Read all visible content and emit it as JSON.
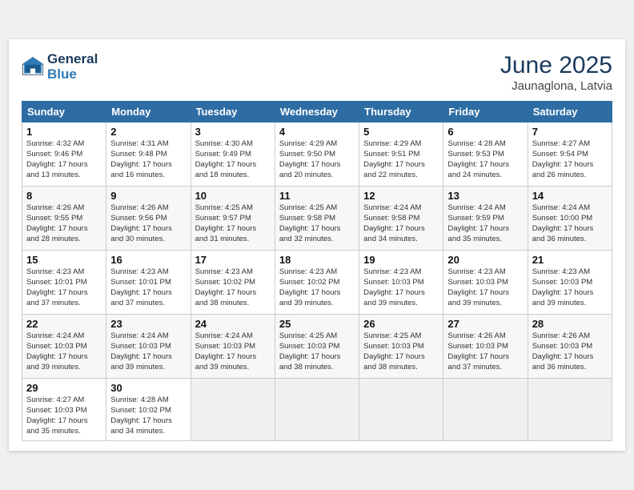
{
  "header": {
    "logo_line1": "General",
    "logo_line2": "Blue",
    "month": "June 2025",
    "location": "Jaunaglona, Latvia"
  },
  "weekdays": [
    "Sunday",
    "Monday",
    "Tuesday",
    "Wednesday",
    "Thursday",
    "Friday",
    "Saturday"
  ],
  "weeks": [
    [
      {
        "day": "1",
        "rise": "4:32 AM",
        "set": "9:46 PM",
        "daylight": "17 hours and 13 minutes."
      },
      {
        "day": "2",
        "rise": "4:31 AM",
        "set": "9:48 PM",
        "daylight": "17 hours and 16 minutes."
      },
      {
        "day": "3",
        "rise": "4:30 AM",
        "set": "9:49 PM",
        "daylight": "17 hours and 18 minutes."
      },
      {
        "day": "4",
        "rise": "4:29 AM",
        "set": "9:50 PM",
        "daylight": "17 hours and 20 minutes."
      },
      {
        "day": "5",
        "rise": "4:29 AM",
        "set": "9:51 PM",
        "daylight": "17 hours and 22 minutes."
      },
      {
        "day": "6",
        "rise": "4:28 AM",
        "set": "9:53 PM",
        "daylight": "17 hours and 24 minutes."
      },
      {
        "day": "7",
        "rise": "4:27 AM",
        "set": "9:54 PM",
        "daylight": "17 hours and 26 minutes."
      }
    ],
    [
      {
        "day": "8",
        "rise": "4:26 AM",
        "set": "9:55 PM",
        "daylight": "17 hours and 28 minutes."
      },
      {
        "day": "9",
        "rise": "4:26 AM",
        "set": "9:56 PM",
        "daylight": "17 hours and 30 minutes."
      },
      {
        "day": "10",
        "rise": "4:25 AM",
        "set": "9:57 PM",
        "daylight": "17 hours and 31 minutes."
      },
      {
        "day": "11",
        "rise": "4:25 AM",
        "set": "9:58 PM",
        "daylight": "17 hours and 32 minutes."
      },
      {
        "day": "12",
        "rise": "4:24 AM",
        "set": "9:58 PM",
        "daylight": "17 hours and 34 minutes."
      },
      {
        "day": "13",
        "rise": "4:24 AM",
        "set": "9:59 PM",
        "daylight": "17 hours and 35 minutes."
      },
      {
        "day": "14",
        "rise": "4:24 AM",
        "set": "10:00 PM",
        "daylight": "17 hours and 36 minutes."
      }
    ],
    [
      {
        "day": "15",
        "rise": "4:23 AM",
        "set": "10:01 PM",
        "daylight": "17 hours and 37 minutes."
      },
      {
        "day": "16",
        "rise": "4:23 AM",
        "set": "10:01 PM",
        "daylight": "17 hours and 37 minutes."
      },
      {
        "day": "17",
        "rise": "4:23 AM",
        "set": "10:02 PM",
        "daylight": "17 hours and 38 minutes."
      },
      {
        "day": "18",
        "rise": "4:23 AM",
        "set": "10:02 PM",
        "daylight": "17 hours and 39 minutes."
      },
      {
        "day": "19",
        "rise": "4:23 AM",
        "set": "10:03 PM",
        "daylight": "17 hours and 39 minutes."
      },
      {
        "day": "20",
        "rise": "4:23 AM",
        "set": "10:03 PM",
        "daylight": "17 hours and 39 minutes."
      },
      {
        "day": "21",
        "rise": "4:23 AM",
        "set": "10:03 PM",
        "daylight": "17 hours and 39 minutes."
      }
    ],
    [
      {
        "day": "22",
        "rise": "4:24 AM",
        "set": "10:03 PM",
        "daylight": "17 hours and 39 minutes."
      },
      {
        "day": "23",
        "rise": "4:24 AM",
        "set": "10:03 PM",
        "daylight": "17 hours and 39 minutes."
      },
      {
        "day": "24",
        "rise": "4:24 AM",
        "set": "10:03 PM",
        "daylight": "17 hours and 39 minutes."
      },
      {
        "day": "25",
        "rise": "4:25 AM",
        "set": "10:03 PM",
        "daylight": "17 hours and 38 minutes."
      },
      {
        "day": "26",
        "rise": "4:25 AM",
        "set": "10:03 PM",
        "daylight": "17 hours and 38 minutes."
      },
      {
        "day": "27",
        "rise": "4:26 AM",
        "set": "10:03 PM",
        "daylight": "17 hours and 37 minutes."
      },
      {
        "day": "28",
        "rise": "4:26 AM",
        "set": "10:03 PM",
        "daylight": "17 hours and 36 minutes."
      }
    ],
    [
      {
        "day": "29",
        "rise": "4:27 AM",
        "set": "10:03 PM",
        "daylight": "17 hours and 35 minutes."
      },
      {
        "day": "30",
        "rise": "4:28 AM",
        "set": "10:02 PM",
        "daylight": "17 hours and 34 minutes."
      },
      null,
      null,
      null,
      null,
      null
    ]
  ]
}
